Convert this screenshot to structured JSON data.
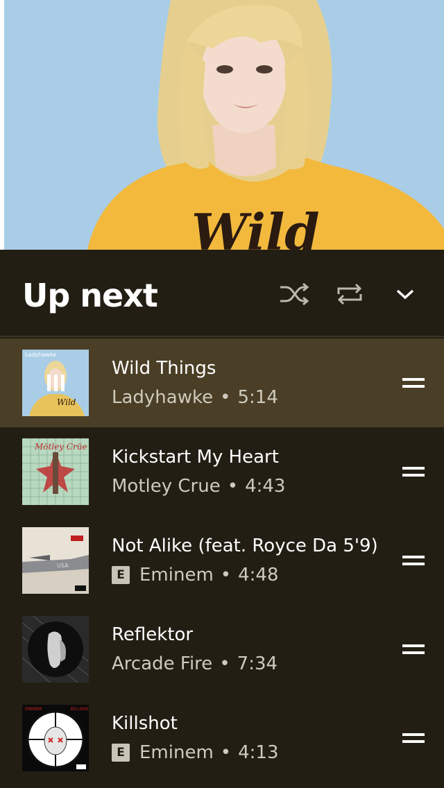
{
  "now_playing_art": {
    "shirt_text": "Wild",
    "album_label": "Ladyhawke"
  },
  "header": {
    "title": "Up next",
    "shuffle_icon": "shuffle-icon",
    "repeat_icon": "repeat-icon",
    "collapse_icon": "chevron-down-icon"
  },
  "queue": [
    {
      "title": "Wild Things",
      "artist": "Ladyhawke",
      "duration": "5:14",
      "explicit": false,
      "active": true,
      "art_colors": [
        "#a9cde6",
        "#e8c25a"
      ]
    },
    {
      "title": "Kickstart My Heart",
      "artist": "Motley Crue",
      "duration": "4:43",
      "explicit": false,
      "active": false,
      "art_colors": [
        "#b8d8c0",
        "#c03030"
      ]
    },
    {
      "title": "Not Alike (feat. Royce Da 5'9)",
      "artist": "Eminem",
      "duration": "4:48",
      "explicit": true,
      "explicit_label": "E",
      "active": false,
      "art_colors": [
        "#e8e2d6",
        "#8a8c90"
      ]
    },
    {
      "title": "Reflektor",
      "artist": "Arcade Fire",
      "duration": "7:34",
      "explicit": false,
      "active": false,
      "art_colors": [
        "#1a1a1a",
        "#cfcfcf"
      ]
    },
    {
      "title": "Killshot",
      "artist": "Eminem",
      "duration": "4:13",
      "explicit": true,
      "explicit_label": "E",
      "active": false,
      "art_colors": [
        "#0a0a0a",
        "#ffffff"
      ]
    }
  ],
  "separator": "•",
  "colors": {
    "background": "#221e14",
    "active_row": "#4a3f26",
    "text_primary": "#ffffff",
    "text_secondary": "#cfcabd"
  }
}
